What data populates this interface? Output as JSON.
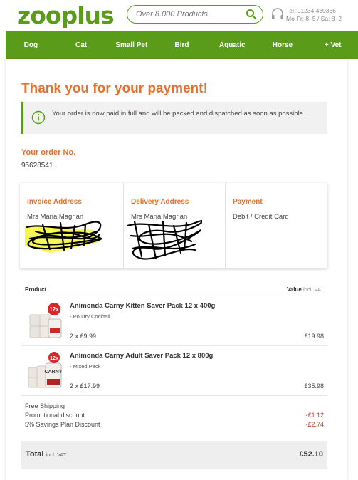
{
  "header": {
    "logo": "zooplus",
    "search_placeholder": "Over 8.000 Products",
    "phone": "Tel. 01234 430366",
    "hours": "Mo-Fr: 8–5 / Sa: 8–2"
  },
  "nav": {
    "items": [
      "Dog",
      "Cat",
      "Small Pet",
      "Bird",
      "Aquatic",
      "Horse",
      "+ Vet"
    ]
  },
  "confirmation": {
    "title": "Thank you for your payment!",
    "info": "Your order is now paid in full and will be packed and dispatched as soon as possible."
  },
  "order": {
    "label": "Your order No.",
    "number": "95628541"
  },
  "addresses": {
    "invoice": {
      "heading": "Invoice Address",
      "name": "Mrs Maria Magrian"
    },
    "delivery": {
      "heading": "Delivery Address",
      "name": "Mrs Maria Magrian"
    },
    "payment": {
      "heading": "Payment",
      "method": "Debit / Credit Card"
    }
  },
  "table": {
    "col_product": "Product",
    "col_value": "Value",
    "col_value_note": "incl. VAT",
    "items": [
      {
        "name": "Animonda Carny Kitten Saver Pack 12 x 400g",
        "variant": "- Poultry Cocktail",
        "qty": "2 x £9.99",
        "price": "£19.98"
      },
      {
        "name": "Animonda Carny Adult Saver Pack 12 x 800g",
        "variant": "- Mixed Pack",
        "qty": "2 x £17.99",
        "price": "£35.98"
      }
    ]
  },
  "summary": {
    "shipping": "Free Shipping",
    "promo_label": "Promotional discount",
    "promo_value": "-£1.12",
    "savings_label": "5% Savings Plan Discount",
    "savings_value": "-£2.74"
  },
  "total": {
    "label": "Total",
    "note": "incl. VAT",
    "value": "£52.10"
  },
  "colors": {
    "brand_green": "#5a9b1a",
    "accent_orange": "#e8702a",
    "discount_red": "#c0392b"
  }
}
